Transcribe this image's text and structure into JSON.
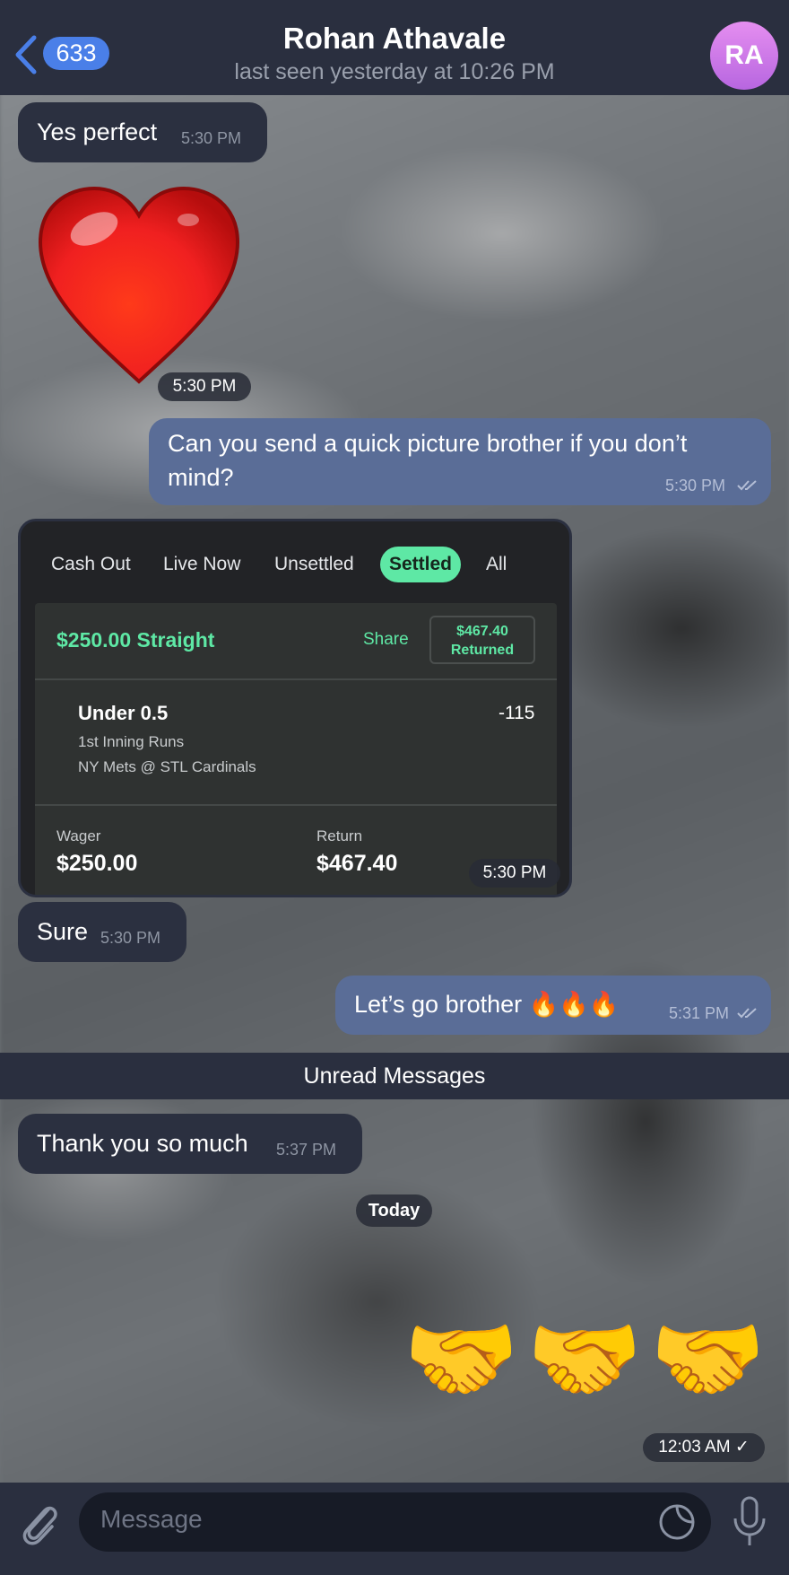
{
  "header": {
    "back_count": "633",
    "title": "Rohan Athavale",
    "status": "last seen yesterday at 10:26 PM",
    "avatar_initials": "RA"
  },
  "messages": {
    "m1": {
      "text": "Yes perfect",
      "time": "5:30 PM"
    },
    "sticker_time": "5:30 PM",
    "m2": {
      "text": "Can you send a quick picture brother if you don’t mind?",
      "time": "5:30 PM"
    },
    "bet_card": {
      "tabs": [
        "Cash Out",
        "Live Now",
        "Unsettled",
        "Settled",
        "All"
      ],
      "active_tab": "Settled",
      "bet_title": "$250.00 Straight",
      "share": "Share",
      "returned_amount": "$467.40",
      "returned_label": "Returned",
      "pick": "Under 0.5",
      "odds": "-115",
      "market": "1st Inning Runs",
      "matchup": "NY Mets @ STL Cardinals",
      "wager_label": "Wager",
      "wager_value": "$250.00",
      "return_label": "Return",
      "return_value": "$467.40",
      "time": "5:30 PM"
    },
    "m3": {
      "text": "Sure",
      "time": "5:30 PM"
    },
    "m4": {
      "text": "Let’s go brother 🔥🔥🔥",
      "time": "5:31 PM"
    },
    "unread_label": "Unread Messages",
    "m5": {
      "text": "Thank you so much",
      "time": "5:37 PM"
    },
    "date_divider": "Today",
    "m6": {
      "emoji": "🤝🤝🤝",
      "time": "12:03 AM"
    }
  },
  "input": {
    "placeholder": "Message"
  },
  "icons": {
    "back": "chevron-left-icon",
    "attach": "paperclip-icon",
    "sticker": "sticker-icon",
    "mic": "microphone-icon"
  },
  "colors": {
    "header_bg": "#2a2f3f",
    "incoming_bubble": "#2b3040",
    "outgoing_bubble": "#5a6d97",
    "accent_blue": "#4a7fe8",
    "bet_green": "#5ee8a5"
  }
}
